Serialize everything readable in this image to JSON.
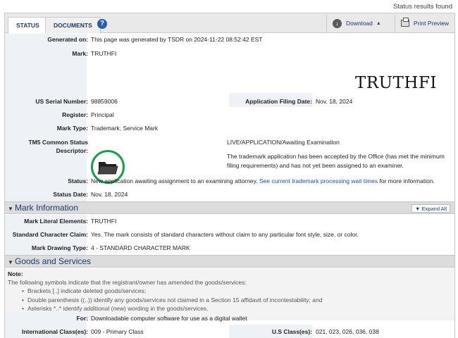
{
  "top": {
    "status_found": "Status results found"
  },
  "tabs": {
    "status": "STATUS",
    "documents": "DOCUMENTS",
    "help": "?"
  },
  "toolbar": {
    "download": "Download",
    "print": "Print Preview"
  },
  "status": {
    "generated_on_label": "Generated on:",
    "generated_on": "This page was generated by TSDR on 2024-11-22 08:52:42 EST",
    "mark_label": "Mark:",
    "mark": "TRUTHFI",
    "mark_image_text": "TRUTHFI",
    "serial_label": "US Serial Number:",
    "serial": "98859006",
    "filing_label": "Application Filing Date:",
    "filing": "Nov. 18, 2024",
    "register_label": "Register:",
    "register": "Principal",
    "mark_type_label": "Mark Type:",
    "mark_type": "Trademark, Service Mark",
    "tm5_label_1": "TM5 Common Status",
    "tm5_label_2": "Descriptor:",
    "tm5_title": "LIVE/APPLICATION/Awaiting Examination",
    "tm5_desc_1": "The trademark application has been accepted by the Office (has met the minimum",
    "tm5_desc_2": "filing requirements) and has not yet been assigned to an examiner.",
    "status_label": "Status:",
    "status_text": "New application awaiting assignment to an examining attorney.",
    "status_link": "See current trademark processing wait times",
    "status_tail": "for more information.",
    "status_date_label": "Status Date:",
    "status_date": "Nov. 18, 2024"
  },
  "mark_info": {
    "title": "Mark Information",
    "expand": "Expand All",
    "literal_label": "Mark Literal Elements:",
    "literal": "TRUTHFI",
    "std_char_label": "Standard Character Claim:",
    "std_char": "Yes. The mark consists of standard characters without claim to any particular font style, size, or color.",
    "drawing_label": "Mark Drawing Type:",
    "drawing": "4 - STANDARD CHARACTER MARK"
  },
  "goods": {
    "title": "Goods and Services",
    "note_label": "Note:",
    "note_body": "The following symbols indicate that the registrant/owner has amended the goods/services:",
    "bullets": [
      "Brackets [..] indicate deleted goods/services;",
      "Double parenthesis ((..)) identify any goods/services not claimed in a Section 15 affidavit of incontestability; and",
      "Asterisks *..* identify additional (new) wording in the goods/services."
    ],
    "for_label": "For:",
    "for": "Downloadable computer software for use as a digital wallet",
    "intl_label": "International Class(es):",
    "intl": "009 - Primary Class",
    "us_label": "U.S Class(es):",
    "us": "021, 023, 026, 036, 038"
  }
}
